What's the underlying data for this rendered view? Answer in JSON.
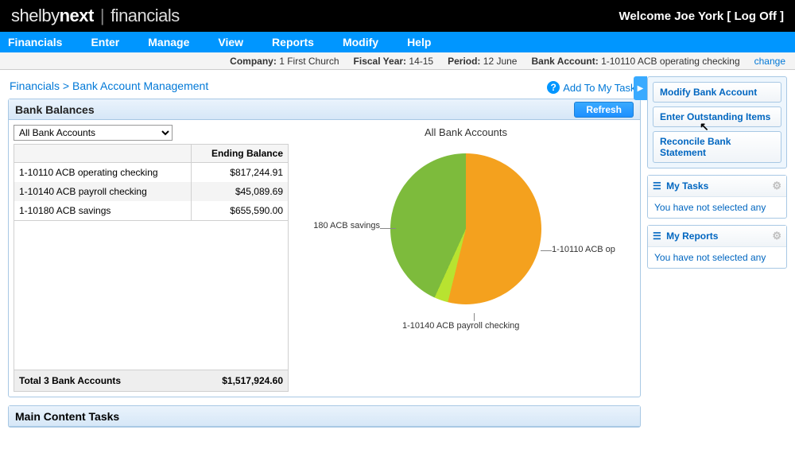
{
  "brand": {
    "p1": "shelby",
    "p2": "next",
    "p3": "financials"
  },
  "welcome": {
    "text": "Welcome Joe York",
    "logoff": "[ Log Off ]"
  },
  "menu": [
    "Financials",
    "Enter",
    "Manage",
    "View",
    "Reports",
    "Modify",
    "Help"
  ],
  "context": {
    "company_label": "Company:",
    "company": "1 First Church",
    "fy_label": "Fiscal Year:",
    "fy": "14-15",
    "period_label": "Period:",
    "period": "12 June",
    "ba_label": "Bank Account:",
    "ba": "1-10110 ACB operating checking",
    "change": "change"
  },
  "breadcrumb": {
    "root": "Financials",
    "arrow": ">",
    "page": "Bank Account Management"
  },
  "add_to_tasks": "Add To My Tasks",
  "panel_title": "Bank Balances",
  "refresh": "Refresh",
  "account_select": {
    "selected": "All Bank Accounts"
  },
  "table": {
    "col1": "",
    "col2": "Ending Balance",
    "rows": [
      {
        "name": "1-10110 ACB operating checking",
        "bal": "$817,244.91"
      },
      {
        "name": "1-10140 ACB payroll checking",
        "bal": "$45,089.69"
      },
      {
        "name": "1-10180 ACB savings",
        "bal": "$655,590.00"
      }
    ],
    "total_label": "Total 3 Bank Accounts",
    "total_value": "$1,517,924.60"
  },
  "chart_data": {
    "type": "pie",
    "title": "All Bank Accounts",
    "labels": {
      "op": "1-10110 ACB op",
      "payroll": "1-10140 ACB payroll checking",
      "savings": "180 ACB savings"
    },
    "series": [
      {
        "name": "1-10110 ACB operating checking",
        "value": 817244.91,
        "color": "#f4a11e"
      },
      {
        "name": "1-10140 ACB payroll checking",
        "value": 45089.69,
        "color": "#b8e330"
      },
      {
        "name": "1-10180 ACB savings",
        "value": 655590.0,
        "color": "#7dbb3c"
      }
    ],
    "total": 1517924.6
  },
  "side_actions": [
    "Modify Bank Account",
    "Enter Outstanding Items",
    "Reconcile Bank Statement"
  ],
  "my_tasks": {
    "title": "My Tasks",
    "empty": "You have not selected any"
  },
  "my_reports": {
    "title": "My Reports",
    "empty": "You have not selected any"
  },
  "panel2_title": "Main Content Tasks"
}
